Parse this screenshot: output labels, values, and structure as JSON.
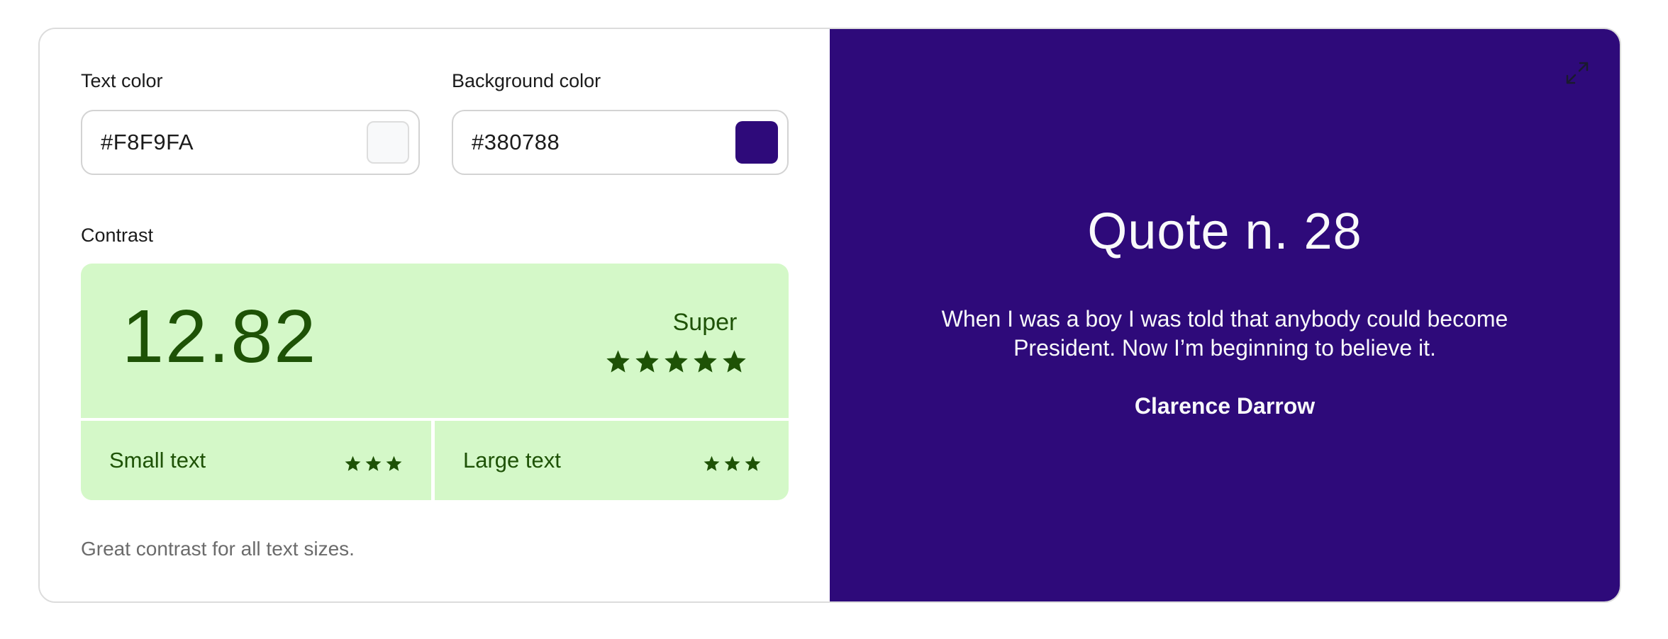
{
  "colors": {
    "accent_bg": "#2E0A7A",
    "text_on_preview": "#F8F9FA",
    "contrast_good_bg": "#D4F8C8",
    "contrast_good_fg": "#1E5206"
  },
  "text_color": {
    "label": "Text color",
    "value": "#F8F9FA",
    "swatch_color": "#F8F9FA"
  },
  "background_color": {
    "label": "Background color",
    "value": "#380788",
    "swatch_color": "#2E0A7A"
  },
  "contrast": {
    "label": "Contrast",
    "ratio": "12.82",
    "rating": "Super",
    "rating_stars": 5,
    "small_text": {
      "label": "Small text",
      "stars": 3
    },
    "large_text": {
      "label": "Large text",
      "stars": 3
    },
    "note": "Great contrast for all text sizes."
  },
  "preview": {
    "title": "Quote n. 28",
    "quote": "When I was a boy I was told that anybody could become President. Now I’m beginning to believe it.",
    "author": "Clarence Darrow",
    "expand_icon": "expand-icon"
  }
}
